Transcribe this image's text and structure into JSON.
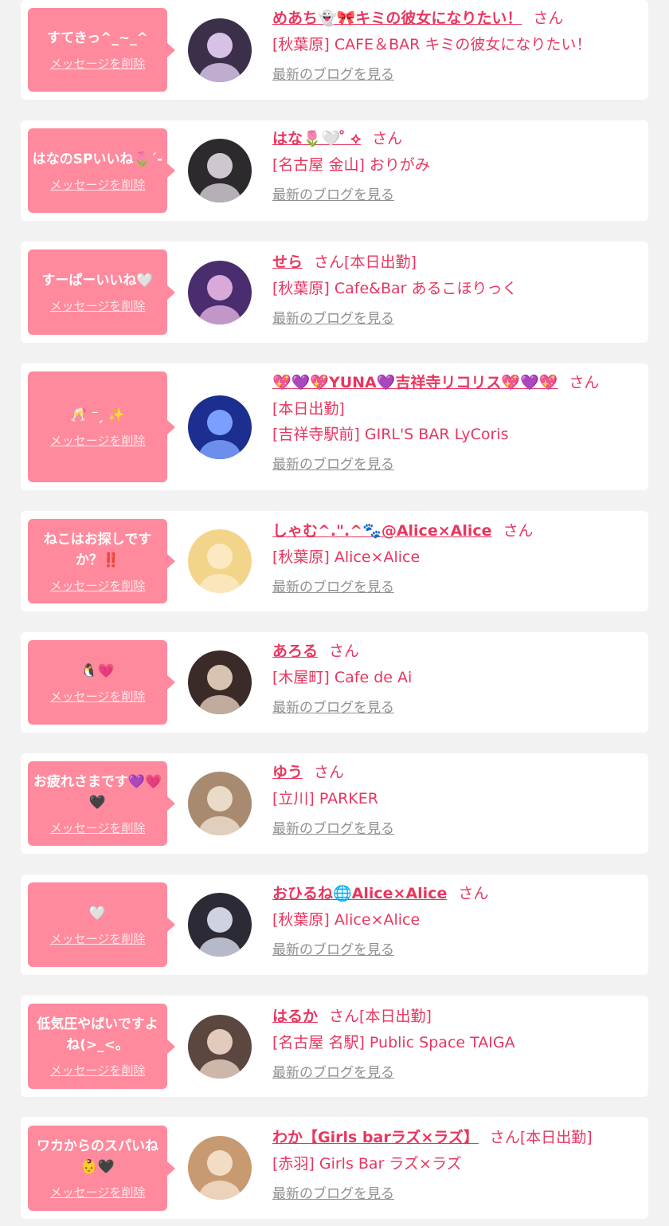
{
  "colors": {
    "background": "#f2f2f2",
    "bubble": "#ff8a9d",
    "accent": "#e8365f",
    "link_gray": "#8f8f8f"
  },
  "common": {
    "delete_label": "メッセージを削除",
    "blog_link": "最新のブログを見る",
    "san_suffix": "さん"
  },
  "items": [
    {
      "message": "すてきっ^_~_^",
      "name": "めあち👻🎀キミの彼女になりたい！",
      "status": "",
      "details": [
        "[秋葉原] CAFE＆BAR キミの彼女になりたい！"
      ]
    },
    {
      "message": "はなのSPいいね🌷´-",
      "name": "はな🌷🤍 ̊ ⟡",
      "status": "",
      "details": [
        "[名古屋 金山] おりがみ"
      ]
    },
    {
      "message": "すーぱーいいね🤍",
      "name": "せら",
      "status": "[本日出勤]",
      "details": [
        "[秋葉原] Cafe&Bar あるこほりっく"
      ]
    },
    {
      "message": "🥂 ⁻ ̗ ✨",
      "name": "💖💜💖YUNA💜吉祥寺リコリス💖💜💖",
      "status": "",
      "details": [
        "[本日出勤]",
        "[吉祥寺駅前] GIRL'S BAR LyCoris"
      ]
    },
    {
      "message": "ねこはお探しですか？‼️",
      "name": "しゃむ^.\".^🐾@Alice×Alice",
      "status": "",
      "details": [
        "[秋葉原] Alice×Alice"
      ]
    },
    {
      "message": "🐧💗",
      "name": "あろる",
      "status": "",
      "details": [
        "[木屋町] Cafe de Ai"
      ]
    },
    {
      "message": "お疲れさまです💜💗🖤",
      "name": "ゆう",
      "status": "",
      "details": [
        "[立川] PARKER"
      ]
    },
    {
      "message": "🤍",
      "name": "おひるね🌐Alice×Alice",
      "status": "",
      "details": [
        "[秋葉原] Alice×Alice"
      ]
    },
    {
      "message": "低気圧やばいですよね(>_<。",
      "name": "はるか",
      "status": "[本日出勤]",
      "details": [
        "[名古屋 名駅] Public Space TAIGA"
      ]
    },
    {
      "message": "ワカからのスパいね👶🖤",
      "name": "わか【Girls barラズ×ラズ】",
      "status": "[本日出勤]",
      "details": [
        "[赤羽] Girls Bar ラズ×ラズ"
      ]
    }
  ]
}
